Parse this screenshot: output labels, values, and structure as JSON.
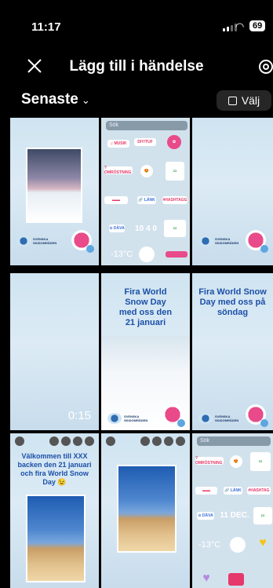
{
  "status_bar": {
    "time": "11:17",
    "battery": "69"
  },
  "header": {
    "title": "Lägg till i händelse"
  },
  "filter": {
    "recent_label": "Senaste",
    "select_label": "Välj"
  },
  "tiles": [
    {
      "type": "story"
    },
    {
      "type": "stickers",
      "search": "Sök",
      "temperature": "-13°C",
      "date": "10 4 0"
    },
    {
      "type": "story"
    },
    {
      "type": "video",
      "duration": "0:15"
    },
    {
      "type": "story",
      "headline": "Fira World Snow Day med oss den 21 januari"
    },
    {
      "type": "story",
      "headline": "Fira World Snow Day med oss på söndag"
    },
    {
      "type": "story",
      "headline": "Välkommen till XXX backen den 21 januari och fira World Snow Day 😉"
    },
    {
      "type": "story"
    },
    {
      "type": "stickers",
      "search": "Sök",
      "date": "11 DEC.",
      "temperature": "-13°C"
    }
  ],
  "colors": {
    "background": "#000000",
    "headline": "#1c4fa8",
    "accent_pink": "#e94a8a"
  }
}
